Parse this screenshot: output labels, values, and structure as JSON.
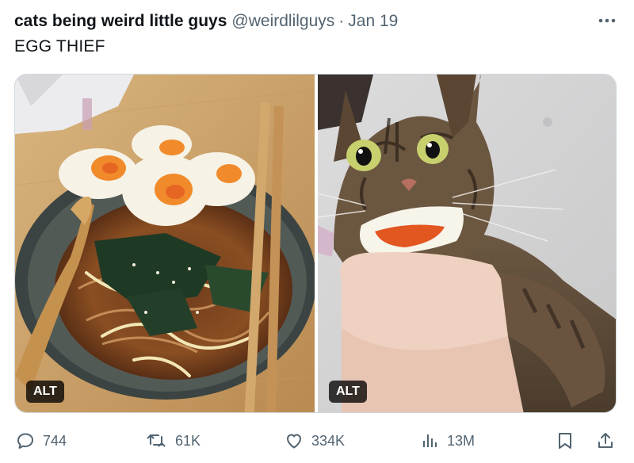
{
  "tweet": {
    "display_name": "cats being weird little guys",
    "handle": "@weirdlilguys",
    "separator": "·",
    "date": "Jan 19",
    "text": "EGG THIEF",
    "more_icon": "more-horizontal-icon"
  },
  "media": [
    {
      "alt_badge": "ALT",
      "subject": "ramen-bowl-with-soft-boiled-eggs"
    },
    {
      "alt_badge": "ALT",
      "subject": "tabby-cat-holding-egg-in-mouth"
    }
  ],
  "actions": {
    "reply": {
      "icon": "reply-icon",
      "count": "744"
    },
    "retweet": {
      "icon": "retweet-icon",
      "count": "61K"
    },
    "like": {
      "icon": "heart-icon",
      "count": "334K"
    },
    "views": {
      "icon": "views-chart-icon",
      "count": "13M"
    },
    "bookmark": {
      "icon": "bookmark-icon"
    },
    "share": {
      "icon": "share-icon"
    }
  },
  "colors": {
    "primary_text": "#0f1419",
    "secondary_text": "#536471",
    "media_border": "#cfd9de",
    "alt_badge_bg": "#000000"
  }
}
